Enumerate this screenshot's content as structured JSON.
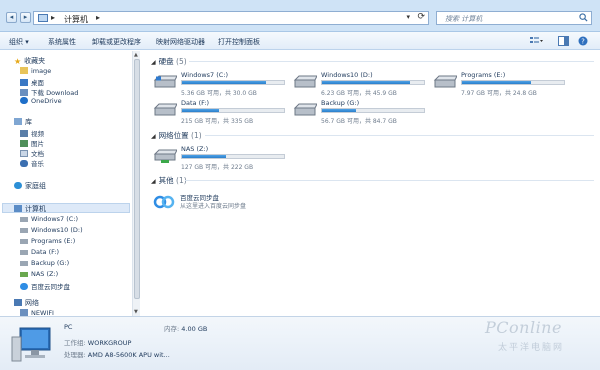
{
  "address_bar": {
    "breadcrumb": "计算机",
    "search_placeholder": "搜索 计算机"
  },
  "toolbar": {
    "items": [
      "组织",
      "系统属性",
      "卸载或更改程序",
      "映射网络驱动器",
      "打开控制面板"
    ]
  },
  "sidebar": {
    "favorites": {
      "label": "收藏夹",
      "items": [
        "image",
        "桌面",
        "下载 Download",
        "OneDrive"
      ]
    },
    "libraries": {
      "label": "库",
      "items": [
        "视频",
        "图片",
        "文档",
        "音乐"
      ]
    },
    "homegroup": {
      "label": "家庭组"
    },
    "computer": {
      "label": "计算机",
      "items": [
        "Windows7 (C:)",
        "Windows10 (D:)",
        "Programs (E:)",
        "Data (F:)",
        "Backup (G:)",
        "NAS (Z:)",
        "百度云同步盘"
      ]
    },
    "network": {
      "label": "网络",
      "items": [
        "NEWIFI"
      ]
    }
  },
  "main": {
    "sections": {
      "hard_disks": {
        "label": "硬盘",
        "count": "(5)"
      },
      "network_locations": {
        "label": "网络位置",
        "count": "(1)"
      },
      "other": {
        "label": "其他",
        "count": "(1)"
      }
    },
    "drives": [
      {
        "name": "Windows7 (C:)",
        "free": "5.36 GB 可用，共 30.0 GB",
        "used_fraction": 0.82
      },
      {
        "name": "Windows10 (D:)",
        "free": "6.23 GB 可用，共 45.9 GB",
        "used_fraction": 0.86
      },
      {
        "name": "Programs (E:)",
        "free": "7.97 GB 可用，共 24.8 GB",
        "used_fraction": 0.68
      },
      {
        "name": "Data (F:)",
        "free": "215 GB 可用，共 335 GB",
        "used_fraction": 0.36
      },
      {
        "name": "Backup (G:)",
        "free": "56.7 GB 可用，共 84.7 GB",
        "used_fraction": 0.33
      }
    ],
    "network_drive": {
      "name": "NAS (Z:)",
      "free": "127 GB 可用，共 222 GB",
      "used_fraction": 0.43
    },
    "cloud": {
      "name": "百度云同步盘",
      "desc": "从这里进入百度云同步盘"
    }
  },
  "details": {
    "name": "PC",
    "memory_label": "内存:",
    "memory_value": "4.00 GB",
    "workgroup_label": "工作组:",
    "workgroup_value": "WORKGROUP",
    "cpu_label": "处理器:",
    "cpu_value": "AMD A8-5600K APU wit..."
  },
  "watermark": {
    "line1": "PConline",
    "line2": "太平洋电脑网"
  },
  "colors": {
    "accent": "#2a7fcc",
    "chrome": "#cfe3f6",
    "text": "#1e395b"
  }
}
